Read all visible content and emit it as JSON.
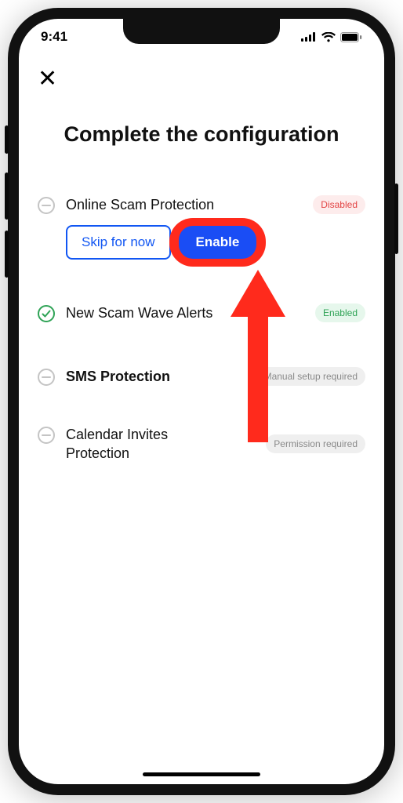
{
  "status_bar": {
    "time": "9:41"
  },
  "title": "Complete the configuration",
  "items": [
    {
      "label": "Online Scam Protection",
      "bold": false,
      "badge": {
        "text": "Disabled",
        "style": "disabled"
      },
      "status": "neutral",
      "actions": {
        "skip": "Skip for now",
        "enable": "Enable"
      }
    },
    {
      "label": "New Scam Wave Alerts",
      "bold": false,
      "badge": {
        "text": "Enabled",
        "style": "enabled"
      },
      "status": "check"
    },
    {
      "label": "SMS Protection",
      "bold": true,
      "badge": {
        "text": "Manual setup required",
        "style": "gray"
      },
      "status": "neutral"
    },
    {
      "label": "Calendar Invites Protection",
      "bold": false,
      "badge": {
        "text": "Permission required",
        "style": "gray"
      },
      "status": "neutral"
    }
  ]
}
